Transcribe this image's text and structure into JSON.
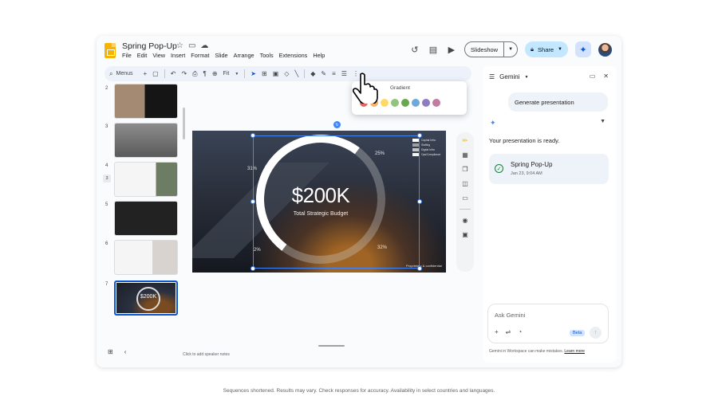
{
  "app": {
    "doc_title": "Spring Pop-Up",
    "menus": [
      "File",
      "Edit",
      "View",
      "Insert",
      "Format",
      "Slide",
      "Arrange",
      "Tools",
      "Extensions",
      "Help"
    ],
    "slideshow_label": "Slideshow",
    "share_label": "Share"
  },
  "toolbar": {
    "search_label": "Menus",
    "zoom_label": "Fit"
  },
  "popup": {
    "label": "Gradient",
    "swatches": [
      "#e06666",
      "#f6b26b",
      "#ffd966",
      "#93c47d",
      "#6aa84f",
      "#6fa8dc",
      "#8e7cc3",
      "#c27ba0"
    ]
  },
  "filmstrip": {
    "numbers": [
      "2",
      "3",
      "4",
      "5",
      "6",
      "7"
    ],
    "badge": "3",
    "thumb_value": "$200K"
  },
  "slide": {
    "value": "$200K",
    "subtitle": "Total Strategic Budget",
    "pct_top_right": "25%",
    "pct_left": "31%",
    "pct_bottom_left": "2%",
    "pct_bottom_right": "32%",
    "legend": [
      {
        "label": "Capital Infra",
        "color": "#ffffff"
      },
      {
        "label": "Staffing",
        "color": "#9aa0a6"
      },
      {
        "label": "Digital Infra",
        "color": "#c4c7c5"
      },
      {
        "label": "Ops/Compliance",
        "color": "#f1f3f4"
      }
    ],
    "footer": "Proprietary & confidential"
  },
  "notes_placeholder": "Click to add speaker notes",
  "gemini": {
    "title": "Gemini",
    "generate_chip": "Generate presentation",
    "ready_text": "Your presentation is ready.",
    "file_title": "Spring Pop-Up",
    "file_date": "Jan 23, 9:04 AM",
    "ask_placeholder": "Ask Gemini",
    "beta_label": "Beta",
    "disclaimer": "Gemini in Workspace can make mistakes.",
    "learn_more": "Learn more"
  },
  "footer_note": "Sequences shortened. Results may vary. Check responses for accuracy. Availability in select countries and languages."
}
